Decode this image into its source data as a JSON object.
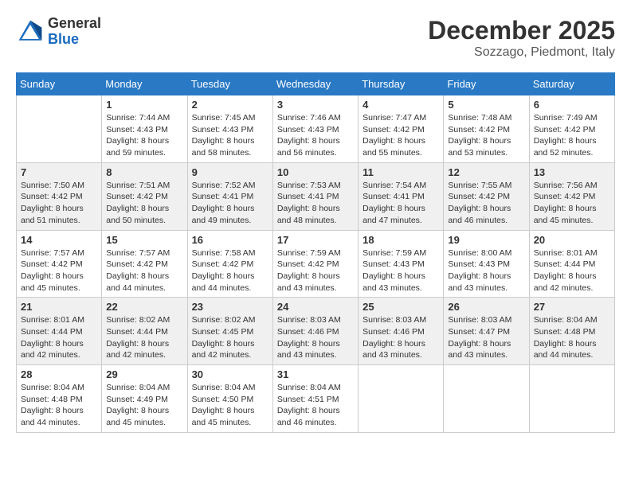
{
  "logo": {
    "general": "General",
    "blue": "Blue"
  },
  "title": "December 2025",
  "location": "Sozzago, Piedmont, Italy",
  "days_of_week": [
    "Sunday",
    "Monday",
    "Tuesday",
    "Wednesday",
    "Thursday",
    "Friday",
    "Saturday"
  ],
  "weeks": [
    [
      {
        "day": "",
        "sunrise": "",
        "sunset": "",
        "daylight": ""
      },
      {
        "day": "1",
        "sunrise": "Sunrise: 7:44 AM",
        "sunset": "Sunset: 4:43 PM",
        "daylight": "Daylight: 8 hours and 59 minutes."
      },
      {
        "day": "2",
        "sunrise": "Sunrise: 7:45 AM",
        "sunset": "Sunset: 4:43 PM",
        "daylight": "Daylight: 8 hours and 58 minutes."
      },
      {
        "day": "3",
        "sunrise": "Sunrise: 7:46 AM",
        "sunset": "Sunset: 4:43 PM",
        "daylight": "Daylight: 8 hours and 56 minutes."
      },
      {
        "day": "4",
        "sunrise": "Sunrise: 7:47 AM",
        "sunset": "Sunset: 4:42 PM",
        "daylight": "Daylight: 8 hours and 55 minutes."
      },
      {
        "day": "5",
        "sunrise": "Sunrise: 7:48 AM",
        "sunset": "Sunset: 4:42 PM",
        "daylight": "Daylight: 8 hours and 53 minutes."
      },
      {
        "day": "6",
        "sunrise": "Sunrise: 7:49 AM",
        "sunset": "Sunset: 4:42 PM",
        "daylight": "Daylight: 8 hours and 52 minutes."
      }
    ],
    [
      {
        "day": "7",
        "sunrise": "Sunrise: 7:50 AM",
        "sunset": "Sunset: 4:42 PM",
        "daylight": "Daylight: 8 hours and 51 minutes."
      },
      {
        "day": "8",
        "sunrise": "Sunrise: 7:51 AM",
        "sunset": "Sunset: 4:42 PM",
        "daylight": "Daylight: 8 hours and 50 minutes."
      },
      {
        "day": "9",
        "sunrise": "Sunrise: 7:52 AM",
        "sunset": "Sunset: 4:41 PM",
        "daylight": "Daylight: 8 hours and 49 minutes."
      },
      {
        "day": "10",
        "sunrise": "Sunrise: 7:53 AM",
        "sunset": "Sunset: 4:41 PM",
        "daylight": "Daylight: 8 hours and 48 minutes."
      },
      {
        "day": "11",
        "sunrise": "Sunrise: 7:54 AM",
        "sunset": "Sunset: 4:41 PM",
        "daylight": "Daylight: 8 hours and 47 minutes."
      },
      {
        "day": "12",
        "sunrise": "Sunrise: 7:55 AM",
        "sunset": "Sunset: 4:42 PM",
        "daylight": "Daylight: 8 hours and 46 minutes."
      },
      {
        "day": "13",
        "sunrise": "Sunrise: 7:56 AM",
        "sunset": "Sunset: 4:42 PM",
        "daylight": "Daylight: 8 hours and 45 minutes."
      }
    ],
    [
      {
        "day": "14",
        "sunrise": "Sunrise: 7:57 AM",
        "sunset": "Sunset: 4:42 PM",
        "daylight": "Daylight: 8 hours and 45 minutes."
      },
      {
        "day": "15",
        "sunrise": "Sunrise: 7:57 AM",
        "sunset": "Sunset: 4:42 PM",
        "daylight": "Daylight: 8 hours and 44 minutes."
      },
      {
        "day": "16",
        "sunrise": "Sunrise: 7:58 AM",
        "sunset": "Sunset: 4:42 PM",
        "daylight": "Daylight: 8 hours and 44 minutes."
      },
      {
        "day": "17",
        "sunrise": "Sunrise: 7:59 AM",
        "sunset": "Sunset: 4:42 PM",
        "daylight": "Daylight: 8 hours and 43 minutes."
      },
      {
        "day": "18",
        "sunrise": "Sunrise: 7:59 AM",
        "sunset": "Sunset: 4:43 PM",
        "daylight": "Daylight: 8 hours and 43 minutes."
      },
      {
        "day": "19",
        "sunrise": "Sunrise: 8:00 AM",
        "sunset": "Sunset: 4:43 PM",
        "daylight": "Daylight: 8 hours and 43 minutes."
      },
      {
        "day": "20",
        "sunrise": "Sunrise: 8:01 AM",
        "sunset": "Sunset: 4:44 PM",
        "daylight": "Daylight: 8 hours and 42 minutes."
      }
    ],
    [
      {
        "day": "21",
        "sunrise": "Sunrise: 8:01 AM",
        "sunset": "Sunset: 4:44 PM",
        "daylight": "Daylight: 8 hours and 42 minutes."
      },
      {
        "day": "22",
        "sunrise": "Sunrise: 8:02 AM",
        "sunset": "Sunset: 4:44 PM",
        "daylight": "Daylight: 8 hours and 42 minutes."
      },
      {
        "day": "23",
        "sunrise": "Sunrise: 8:02 AM",
        "sunset": "Sunset: 4:45 PM",
        "daylight": "Daylight: 8 hours and 42 minutes."
      },
      {
        "day": "24",
        "sunrise": "Sunrise: 8:03 AM",
        "sunset": "Sunset: 4:46 PM",
        "daylight": "Daylight: 8 hours and 43 minutes."
      },
      {
        "day": "25",
        "sunrise": "Sunrise: 8:03 AM",
        "sunset": "Sunset: 4:46 PM",
        "daylight": "Daylight: 8 hours and 43 minutes."
      },
      {
        "day": "26",
        "sunrise": "Sunrise: 8:03 AM",
        "sunset": "Sunset: 4:47 PM",
        "daylight": "Daylight: 8 hours and 43 minutes."
      },
      {
        "day": "27",
        "sunrise": "Sunrise: 8:04 AM",
        "sunset": "Sunset: 4:48 PM",
        "daylight": "Daylight: 8 hours and 44 minutes."
      }
    ],
    [
      {
        "day": "28",
        "sunrise": "Sunrise: 8:04 AM",
        "sunset": "Sunset: 4:48 PM",
        "daylight": "Daylight: 8 hours and 44 minutes."
      },
      {
        "day": "29",
        "sunrise": "Sunrise: 8:04 AM",
        "sunset": "Sunset: 4:49 PM",
        "daylight": "Daylight: 8 hours and 45 minutes."
      },
      {
        "day": "30",
        "sunrise": "Sunrise: 8:04 AM",
        "sunset": "Sunset: 4:50 PM",
        "daylight": "Daylight: 8 hours and 45 minutes."
      },
      {
        "day": "31",
        "sunrise": "Sunrise: 8:04 AM",
        "sunset": "Sunset: 4:51 PM",
        "daylight": "Daylight: 8 hours and 46 minutes."
      },
      {
        "day": "",
        "sunrise": "",
        "sunset": "",
        "daylight": ""
      },
      {
        "day": "",
        "sunrise": "",
        "sunset": "",
        "daylight": ""
      },
      {
        "day": "",
        "sunrise": "",
        "sunset": "",
        "daylight": ""
      }
    ]
  ]
}
